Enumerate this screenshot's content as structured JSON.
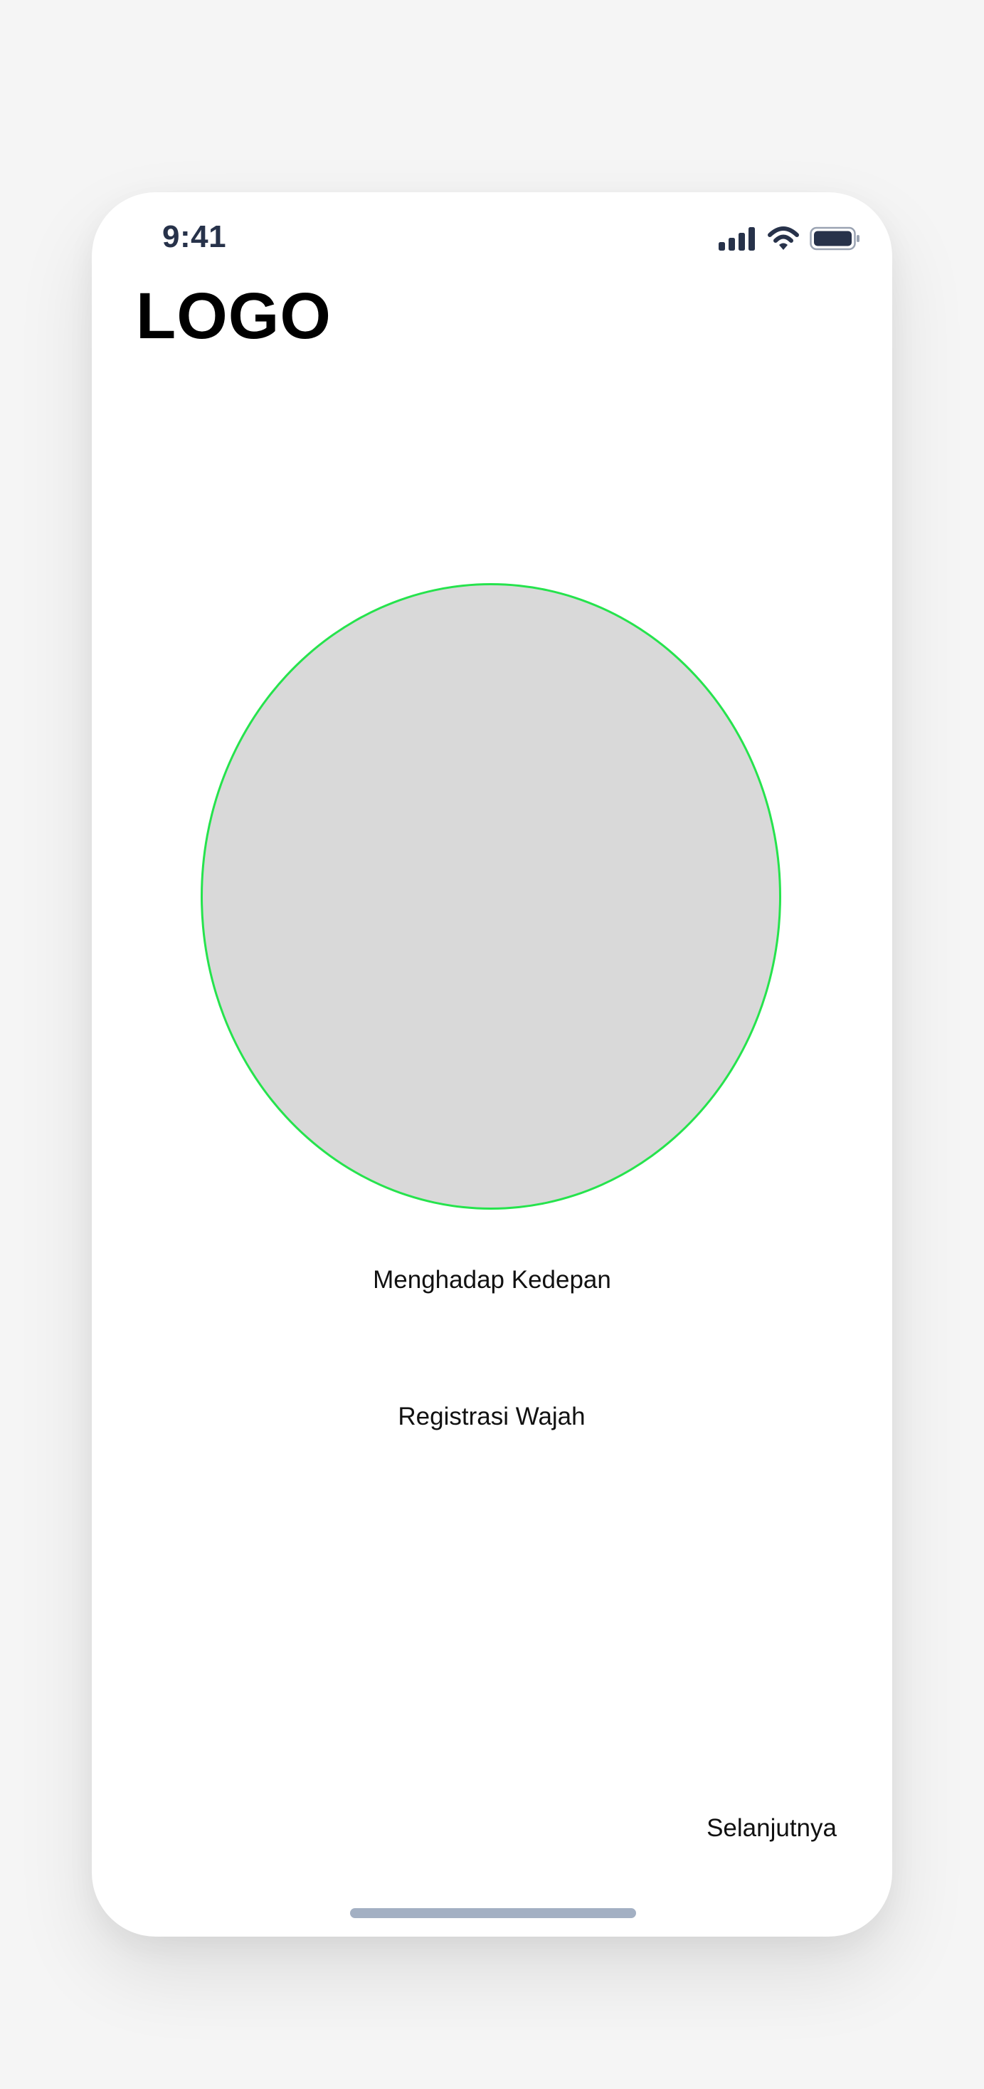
{
  "status_bar": {
    "time": "9:41",
    "icons": [
      "cellular-signal-icon",
      "wifi-icon",
      "battery-icon"
    ]
  },
  "header": {
    "logo_text": "LOGO"
  },
  "camera": {
    "frame_shape": "oval",
    "frame_fill": "#d9d9d9",
    "frame_border_color": "#26e34d"
  },
  "main": {
    "instruction": "Menghadap Kedepan",
    "register_label": "Registrasi Wajah"
  },
  "footer": {
    "next_label": "Selanjutnya"
  },
  "colors": {
    "background": "#f5f5f5",
    "screen": "#ffffff",
    "status_text": "#27324a",
    "home_indicator": "#a3b0c3"
  }
}
